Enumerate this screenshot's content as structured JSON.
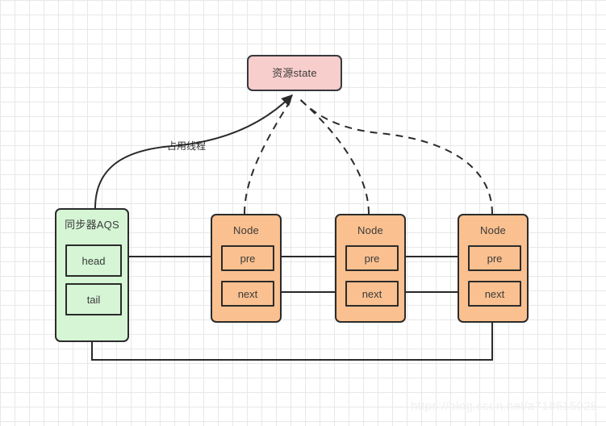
{
  "diagram": {
    "title_watermark": "https://blog.csdn.net/a718515028",
    "state_box": {
      "label": "资源state",
      "fill": "#f8cecc",
      "stroke": "#36393d"
    },
    "aqs_box": {
      "title": "同步器AQS",
      "fill": "#d5f5d5",
      "stroke": "#2b2b2b",
      "fields": [
        {
          "label": "head"
        },
        {
          "label": "tail"
        }
      ]
    },
    "nodes": [
      {
        "title": "Node",
        "fields": [
          {
            "label": "pre"
          },
          {
            "label": "next"
          }
        ]
      },
      {
        "title": "Node",
        "fields": [
          {
            "label": "pre"
          },
          {
            "label": "next"
          }
        ]
      },
      {
        "title": "Node",
        "fields": [
          {
            "label": "pre"
          },
          {
            "label": "next"
          }
        ]
      }
    ],
    "node_style": {
      "fill": "#fac08f",
      "stroke": "#2b2b2b"
    },
    "edges": {
      "hold_thread_label": "占用线程"
    },
    "background": {
      "grid_minor": "#e8e8e8",
      "grid_major": "#d4d4d4",
      "page": "#ffffff"
    }
  }
}
